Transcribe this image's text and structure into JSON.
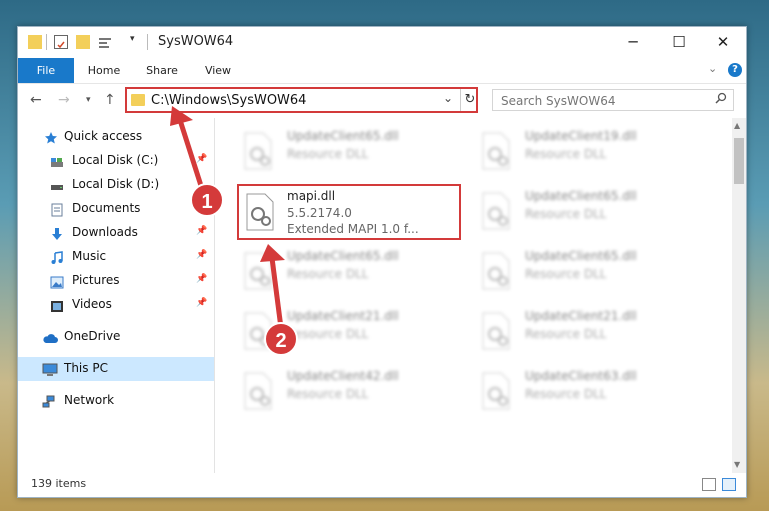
{
  "window": {
    "title": "SysWOW64"
  },
  "ribbon": {
    "tabs": [
      "File",
      "Home",
      "Share",
      "View"
    ]
  },
  "address": {
    "path": "C:\\Windows\\SysWOW64"
  },
  "search": {
    "placeholder": "Search SysWOW64"
  },
  "sidebar": {
    "items": [
      {
        "label": "Quick access",
        "icon": "star-icon",
        "pinned": false
      },
      {
        "label": "Local Disk (C:)",
        "icon": "drive-icon",
        "pinned": true
      },
      {
        "label": "Local Disk (D:)",
        "icon": "drive-icon",
        "pinned": false
      },
      {
        "label": "Documents",
        "icon": "documents-icon",
        "pinned": true
      },
      {
        "label": "Downloads",
        "icon": "download-icon",
        "pinned": true
      },
      {
        "label": "Music",
        "icon": "music-icon",
        "pinned": true
      },
      {
        "label": "Pictures",
        "icon": "pictures-icon",
        "pinned": true
      },
      {
        "label": "Videos",
        "icon": "videos-icon",
        "pinned": true
      },
      {
        "label": "OneDrive",
        "icon": "cloud-icon",
        "pinned": false
      },
      {
        "label": "This PC",
        "icon": "computer-icon",
        "pinned": false,
        "selected": true
      },
      {
        "label": "Network",
        "icon": "network-icon",
        "pinned": false
      }
    ]
  },
  "files": [
    {
      "name": "UpdateClient65.dll",
      "type": "Resource DLL"
    },
    {
      "name": "UpdateClient19.dll",
      "type": "Resource DLL"
    },
    {
      "name": "UpdateClient65.dll",
      "type": "Resource DLL"
    },
    {
      "name": "UpdateClient65.dll",
      "type": "Resource DLL"
    },
    {
      "name": "UpdateClient65.dll",
      "type": "Resource DLL"
    },
    {
      "name": "UpdateClient21.dll",
      "type": "Resource DLL"
    },
    {
      "name": "UpdateClient21.dll",
      "type": "Resource DLL"
    },
    {
      "name": "UpdateClient42.dll",
      "type": "Resource DLL"
    },
    {
      "name": "UpdateClient63.dll",
      "type": "Resource DLL"
    }
  ],
  "highlighted_file": {
    "name": "mapi.dll",
    "version": "5.5.2174.0",
    "description": "Extended MAPI 1.0 f..."
  },
  "status": {
    "item_count": "139 items"
  },
  "annotations": {
    "step1": "1",
    "step2": "2",
    "color": "#d43a3a"
  }
}
